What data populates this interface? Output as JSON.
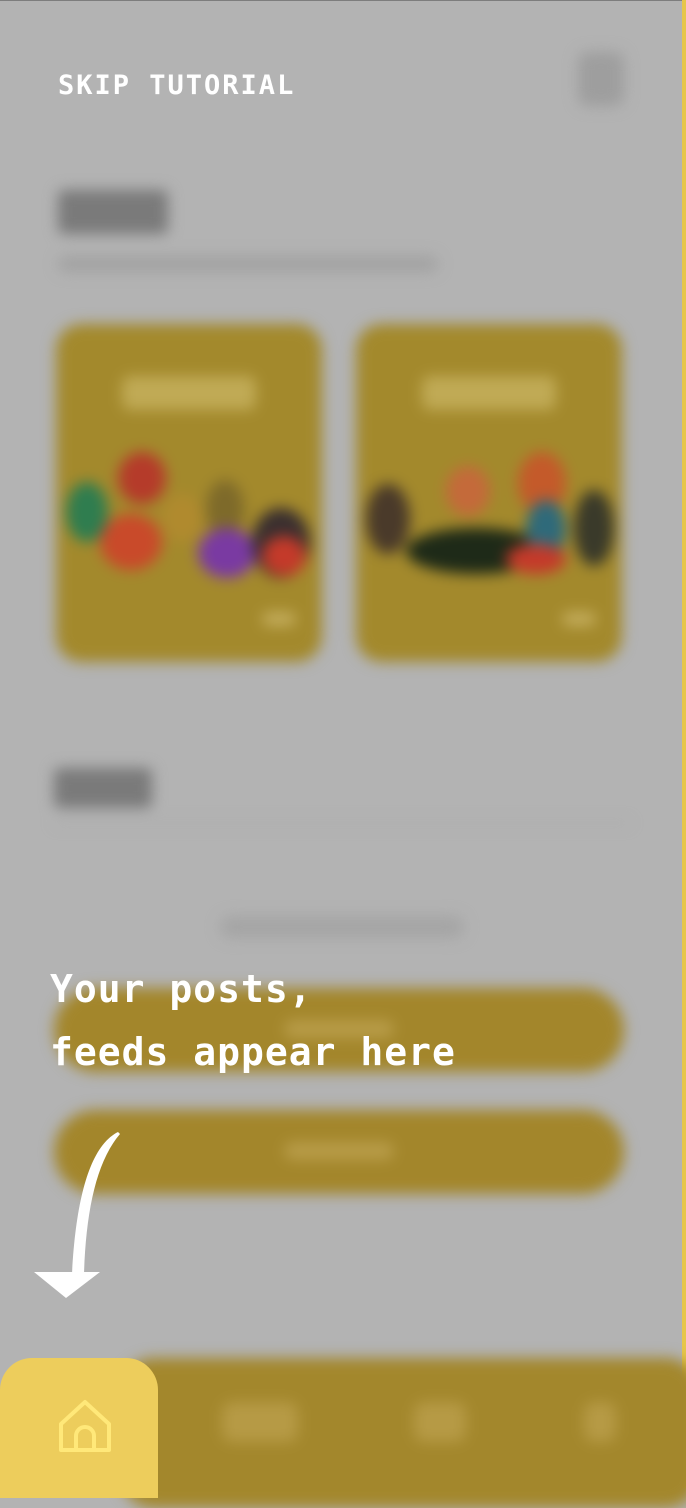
{
  "tutorial": {
    "skip_label": "SKIP TUTORIAL",
    "hint_line1": "Your posts,",
    "hint_line2": "feeds appear here",
    "arrow_icon": "curved-down-arrow-icon"
  },
  "bottom_nav": {
    "active_tab": "home",
    "home_icon": "home-icon",
    "active_color": "#EDCD5C"
  },
  "colors": {
    "overlay": "#B3B3B3",
    "accent": "#E6C64A",
    "card": "#A3892C"
  }
}
